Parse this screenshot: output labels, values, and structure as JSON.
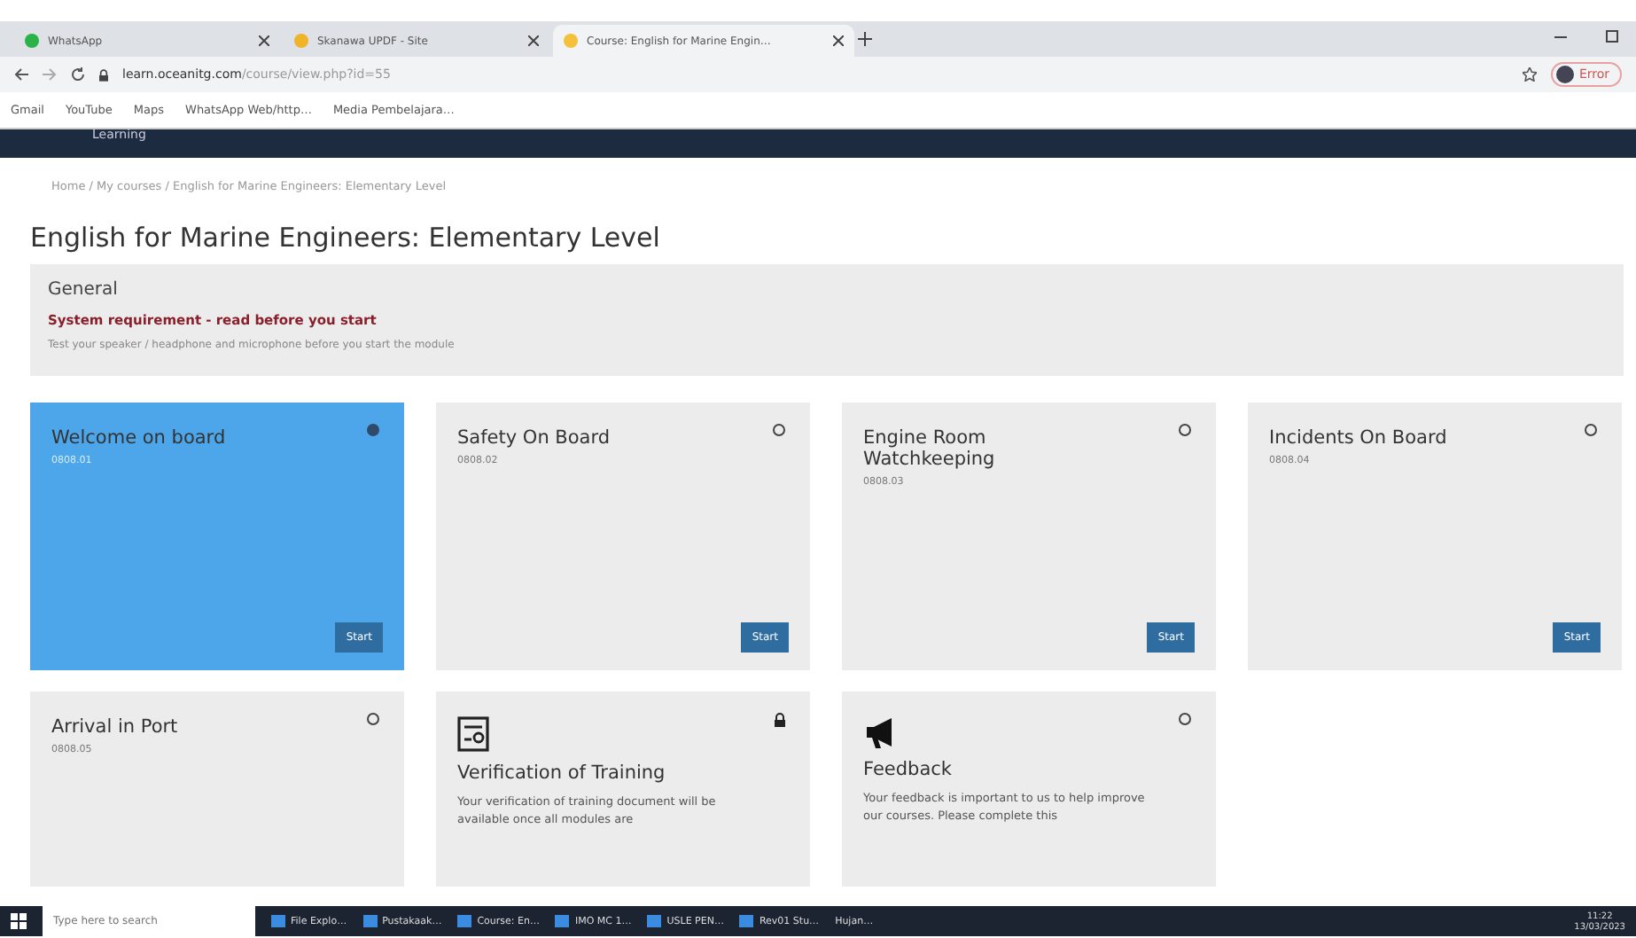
{
  "browser": {
    "tabs": [
      {
        "title": "WhatsApp",
        "selected": false
      },
      {
        "title": "Skanawa UPDF - Site",
        "selected": false
      },
      {
        "title": "Course: English for Marine Engin…",
        "selected": true
      }
    ],
    "url_host": "learn.oceanitg.com",
    "url_path": "/course/view.php?id=55",
    "profile": "Error",
    "bookmarks": [
      "Gmail",
      "YouTube",
      "Maps",
      "WhatsApp Web/http…",
      "Media Pembelajara…"
    ]
  },
  "site_header": {
    "brand": "Learning"
  },
  "breadcrumb": "Home / My courses / English for Marine Engineers: Elementary Level",
  "course_title": "English for Marine Engineers: Elementary Level",
  "general": {
    "heading": "General",
    "notice": "System requirement - read before you start",
    "note": "Test your speaker / headphone and microphone before you start the module"
  },
  "modules": [
    {
      "kind": "module",
      "title": "Welcome on board",
      "code": "0808.01",
      "highlighted": true,
      "completed": true,
      "button": "Start"
    },
    {
      "kind": "module",
      "title": "Safety On Board",
      "code": "0808.02",
      "highlighted": false,
      "completed": false,
      "button": "Start"
    },
    {
      "kind": "module",
      "title": "Engine Room Watchkeeping",
      "code": "0808.03",
      "highlighted": false,
      "completed": false,
      "button": "Start"
    },
    {
      "kind": "module",
      "title": "Incidents On Board",
      "code": "0808.04",
      "highlighted": false,
      "completed": false,
      "button": "Start"
    },
    {
      "kind": "module",
      "title": "Arrival in Port",
      "code": "0808.05",
      "highlighted": false,
      "completed": false
    },
    {
      "kind": "certificate",
      "title": "Verification of Training",
      "text": "Your verification of training document will be available once all modules are",
      "highlighted": false,
      "locked": true
    },
    {
      "kind": "feedback",
      "title": "Feedback",
      "text": "Your feedback is important to us to help improve our courses. Please complete this",
      "highlighted": false,
      "completed": false
    }
  ],
  "taskbar": {
    "search_placeholder": "Type here to search",
    "apps": [
      "File Explo…",
      "Pustakaak…",
      "Course: En…",
      "IMO MC 1…",
      "USLE PEN…",
      "Rev01 Stu…"
    ],
    "weather": "Hujan…",
    "time": "11:22",
    "date": "13/03/2023"
  }
}
